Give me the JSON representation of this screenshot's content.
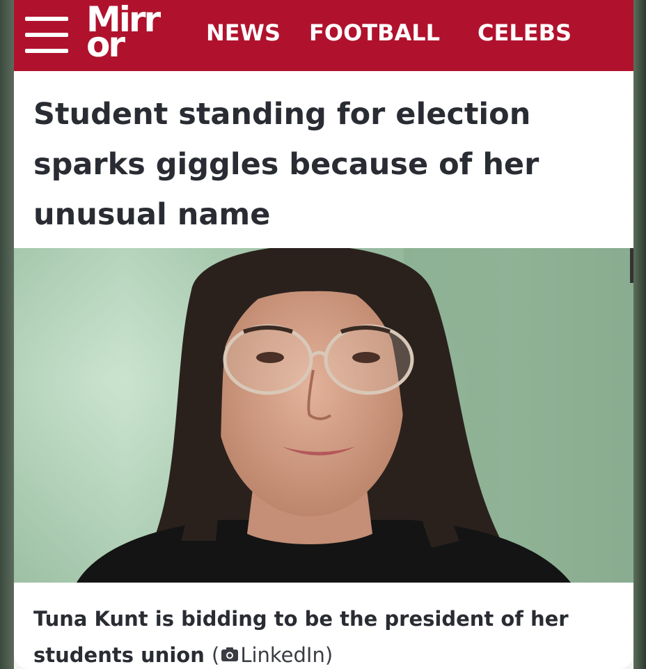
{
  "brand": {
    "logo_line1": "Mirr",
    "logo_line2": "or",
    "color": "#b0122d"
  },
  "nav": {
    "items": [
      "NEWS",
      "FOOTBALL",
      "CELEBS"
    ]
  },
  "article": {
    "headline": "Student standing for election sparks giggles because of her unusual name",
    "caption": "Tuna Kunt is bidding to be the president of her students union",
    "credit_open": "(",
    "credit_source": "LinkedIn)"
  },
  "icons": {
    "menu": "hamburger-menu-icon",
    "credit": "camera-icon"
  }
}
